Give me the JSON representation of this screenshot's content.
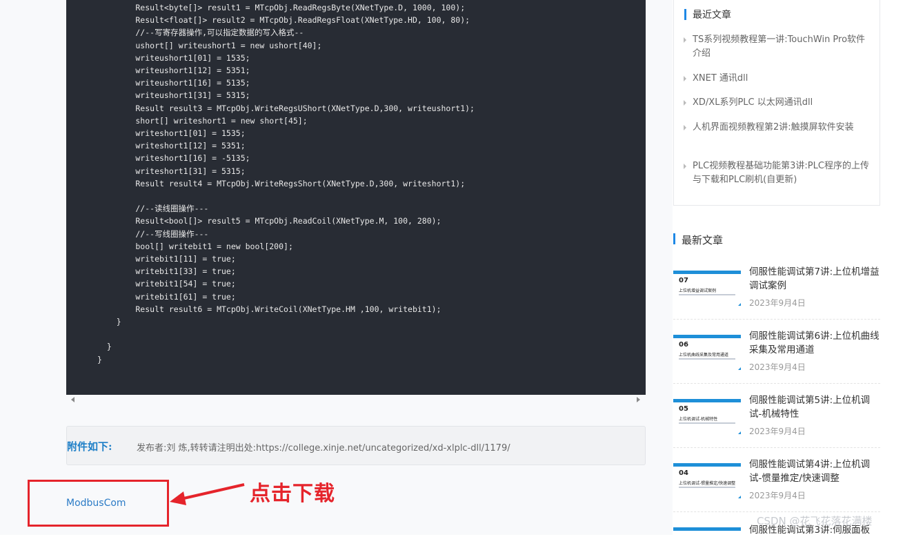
{
  "code": {
    "lines": [
      "        Result<byte[]> result1 = MTcpObj.ReadRegsByte(XNetType.D, 1000, 100);",
      "        Result<float[]> result2 = MTcpObj.ReadRegsFloat(XNetType.HD, 100, 80);",
      "        //--写寄存器操作,可以指定数据的写入格式--",
      "        ushort[] writeushort1 = new ushort[40];",
      "        writeushort1[01] = 1535;",
      "        writeushort1[12] = 5351;",
      "        writeushort1[16] = 5135;",
      "        writeushort1[31] = 5315;",
      "        Result result3 = MTcpObj.WriteRegsUShort(XNetType.D,300, writeushort1);",
      "        short[] writeshort1 = new short[45];",
      "        writeshort1[01] = 1535;",
      "        writeshort1[12] = 5351;",
      "        writeshort1[16] = -5135;",
      "        writeshort1[31] = 5315;",
      "        Result result4 = MTcpObj.WriteRegsShort(XNetType.D,300, writeshort1);",
      "",
      "        //--读线圈操作---",
      "        Result<bool[]> result5 = MTcpObj.ReadCoil(XNetType.M, 100, 280);",
      "        //--写线圈操作---",
      "        bool[] writebit1 = new bool[200];",
      "        writebit1[11] = true;",
      "        writebit1[33] = true;",
      "        writebit1[54] = true;",
      "        writebit1[61] = true;",
      "        Result result6 = MTcpObj.WriteCoil(XNetType.HM ,100, writebit1);",
      "    }",
      "",
      "  }",
      "}"
    ]
  },
  "attachment": {
    "label": "附件如下:",
    "info": "发布者:刘 炼,转转请注明出处:https://college.xinje.net/uncategorized/xd-xlplc-dll/1179/"
  },
  "download_link": "ModbusCom",
  "annotation": {
    "text": "点击下载",
    "color": "#e5242b"
  },
  "sidebar": {
    "recent": {
      "title": "最近文章",
      "items": [
        "TS系列视频教程第一讲:TouchWin Pro软件介绍",
        "XNET 通讯dll",
        "XD/XL系列PLC 以太网通讯dll",
        "人机界面视频教程第2讲:触摸屏软件安装",
        "PLC视频教程基础功能第3讲:PLC程序的上传与下载和PLC刷机(自更新)"
      ]
    },
    "latest": {
      "title": "最新文章",
      "items": [
        {
          "thumb_num": "07",
          "thumb_title": "上位机增益调试案例",
          "title": "伺服性能调试第7讲:上位机增益调试案例",
          "date": "2023年9月4日"
        },
        {
          "thumb_num": "06",
          "thumb_title": "上位机曲线采集及常用通道",
          "title": "伺服性能调试第6讲:上位机曲线采集及常用通道",
          "date": "2023年9月4日"
        },
        {
          "thumb_num": "05",
          "thumb_title": "上位机调试-机械特性",
          "title": "伺服性能调试第5讲:上位机调试-机械特性",
          "date": "2023年9月4日"
        },
        {
          "thumb_num": "04",
          "thumb_title": "上位机调试-惯量推定/快速调整",
          "title": "伺服性能调试第4讲:上位机调试-惯量推定/快速调整",
          "date": "2023年9月4日"
        },
        {
          "thumb_num": "",
          "thumb_title": "",
          "title": "伺服性能调试第3讲:伺服面板",
          "date": ""
        }
      ]
    }
  },
  "watermark": "CSDN @花飞花落花满楼",
  "colors": {
    "accent": "#1e88e5",
    "code_bg": "#282c34",
    "link": "#2b7bc6"
  }
}
